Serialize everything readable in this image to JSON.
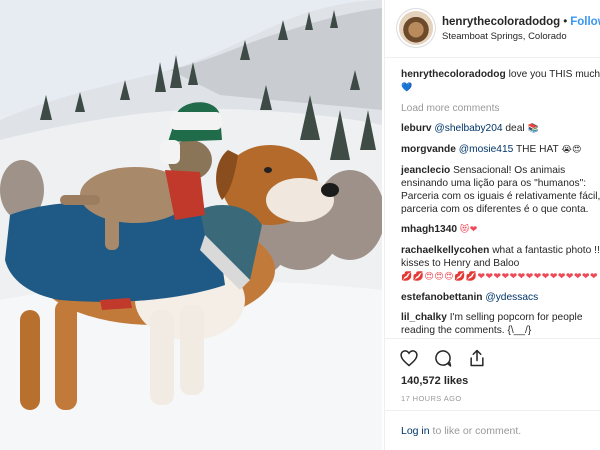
{
  "post": {
    "photo_icon": "dog-and-cat-in-snow-photo",
    "owner": "henrythecoloradodog",
    "dot": "•",
    "follow_label": "Follow",
    "location": "Steamboat Springs, Colorado"
  },
  "caption": {
    "user": "henrythecoloradodog",
    "text": "love you THIS much",
    "emoji": "💙"
  },
  "load_more": "Load more comments",
  "comments": [
    {
      "user": "leburv",
      "mention": "@shelbaby204",
      "text": "deal",
      "emoji": "📚"
    },
    {
      "user": "morgvande",
      "mention": "@mosie415",
      "text": "THE HAT",
      "emoji": "😭😍"
    },
    {
      "user": "jeanclecio",
      "text": "Sensacional! Os animais ensinando uma lição para os \"humanos\": Parceria com os iguais é relativamente fácil, parceria com os diferentes é o que conta."
    },
    {
      "user": "mhagh1340",
      "emoji": "😻❤"
    },
    {
      "user": "rachaelkellycohen",
      "text": "what a fantastic photo !! kisses to Henry and Baloo",
      "emoji": "💋💋😍😍😍💋💋❤❤❤❤❤❤❤❤❤❤❤❤❤❤❤"
    },
    {
      "user": "estefanobettanin",
      "mention": "@ydessacs"
    },
    {
      "user": "lil_chalky",
      "text": "I'm selling popcorn for people reading the comments. {\\__/}"
    }
  ],
  "actions": {
    "icons": [
      "heart-icon",
      "comment-icon",
      "share-icon"
    ],
    "likes": "140,572 likes",
    "time": "17 HOURS AGO"
  },
  "login": {
    "link": "Log in",
    "rest": "to like or comment."
  },
  "colors": {
    "accent": "#3897f0",
    "link": "#003569",
    "muted": "#999999",
    "heart": "#ed4956"
  }
}
